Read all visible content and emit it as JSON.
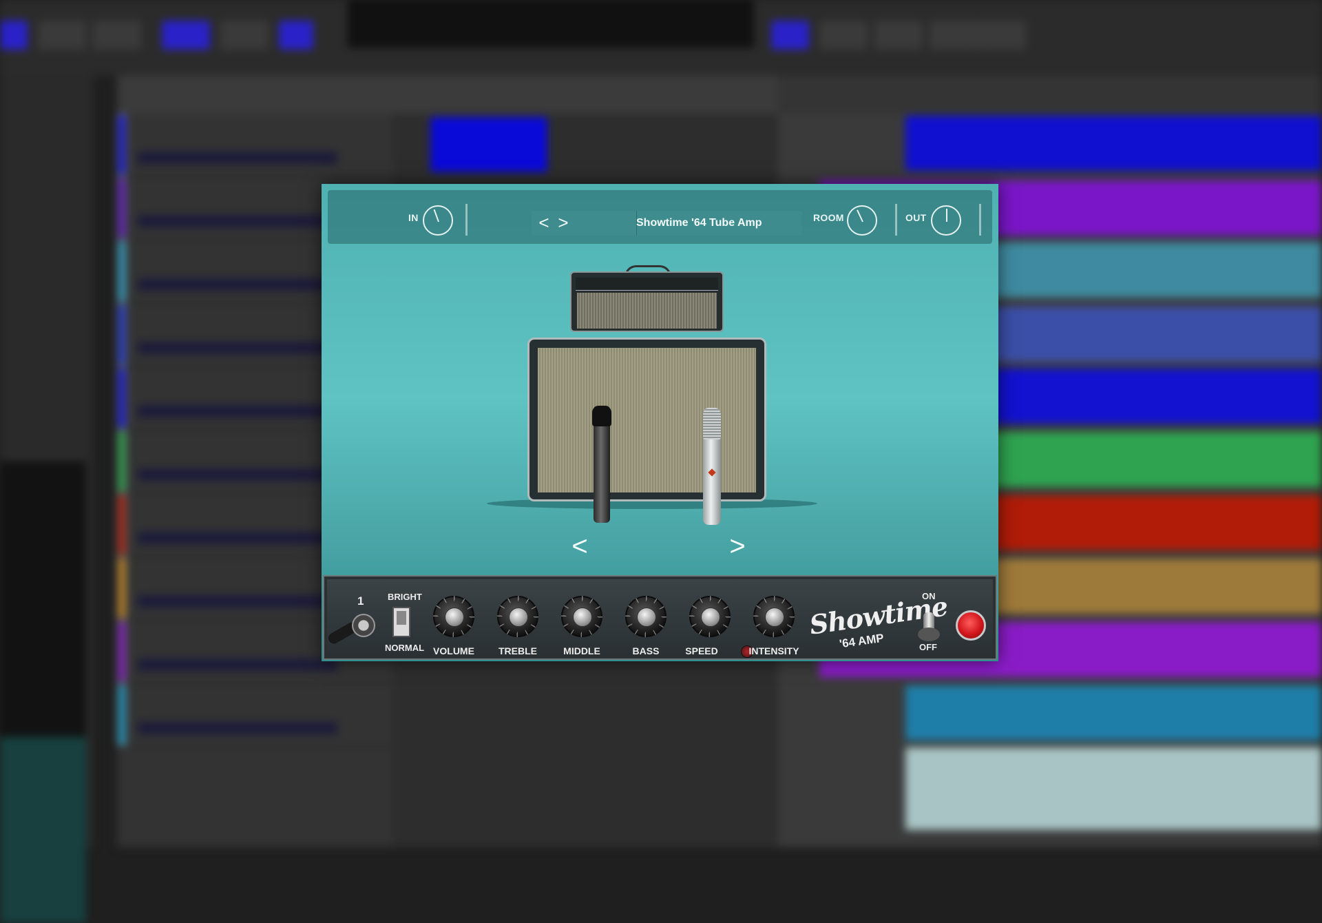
{
  "plugin": {
    "input_label": "IN",
    "preset_name": "Showtime '64 Tube Amp",
    "preset_prev": "<",
    "preset_next": ">",
    "room_label": "ROOM",
    "output_label": "OUT",
    "selector_prev": "<",
    "selector_next": ">"
  },
  "amp_controls": {
    "input_number": "1",
    "bright_label": "BRIGHT",
    "normal_label": "NORMAL",
    "knobs": [
      {
        "label": "VOLUME"
      },
      {
        "label": "TREBLE"
      },
      {
        "label": "MIDDLE"
      },
      {
        "label": "BASS"
      },
      {
        "label": "SPEED"
      },
      {
        "label": "INTENSITY"
      }
    ],
    "logo_title": "Showtime",
    "logo_subtitle": "'64 AMP",
    "on_label": "ON",
    "off_label": "OFF"
  },
  "colors": {
    "plugin_bg": "#5ab9b9",
    "header_bg": "#3c8a8c",
    "power_lamp": "#d1161b"
  },
  "icons": {
    "input_knob": "knob-icon",
    "room_knob": "knob-icon",
    "output_knob": "knob-icon",
    "preset_prev": "chevron-left-icon",
    "preset_next": "chevron-right-icon",
    "input_jack": "jack-icon",
    "power_lamp": "power-lamp-icon"
  }
}
